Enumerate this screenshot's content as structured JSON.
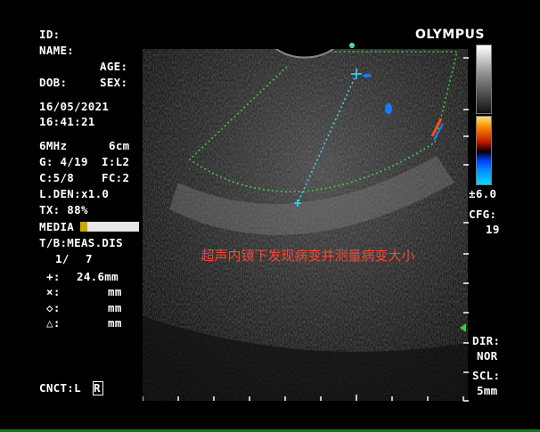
{
  "brand": "OLYMPUS",
  "patient": {
    "id_label": "ID:",
    "name_label": "NAME:",
    "age_label": "AGE:",
    "dob_label": "DOB:",
    "sex_label": "SEX:",
    "date": "16/05/2021",
    "time": "16:41:21"
  },
  "params": {
    "freq": "6MHz",
    "depth": "6cm",
    "gain": "G: 4/19",
    "image_level": "I:L2",
    "contrast": "C:5/8",
    "focus": "FC:2",
    "line_density": "L.DEN:x1.0",
    "tx": "TX: 88%",
    "media": "MEDIA",
    "tb": "T/B:MEAS.DIS"
  },
  "measurements": {
    "index": "1/",
    "total": "7",
    "rows": [
      {
        "symbol": "+:",
        "value": "24.6mm"
      },
      {
        "symbol": "×:",
        "value": "mm"
      },
      {
        "symbol": "◇:",
        "value": "mm"
      },
      {
        "symbol": "△:",
        "value": "mm"
      }
    ]
  },
  "cnct": {
    "label": "CNCT:L",
    "box": "R"
  },
  "right_panel": {
    "velocity": "±6.0",
    "cfg_label": "CFG:",
    "cfg_value": "19",
    "dir_label": "DIR:",
    "dir_value": "NOR",
    "scl_label": "SCL:",
    "scl_value": "5mm"
  },
  "caption": "超声内镜下发现病变并测量病变大小",
  "colors": {
    "sector": "#3fc64a",
    "caliper": "#38d6ff",
    "caption": "#f04a36",
    "doppler_blue": "#1a7bff",
    "doppler_red": "#ff4a1a"
  }
}
